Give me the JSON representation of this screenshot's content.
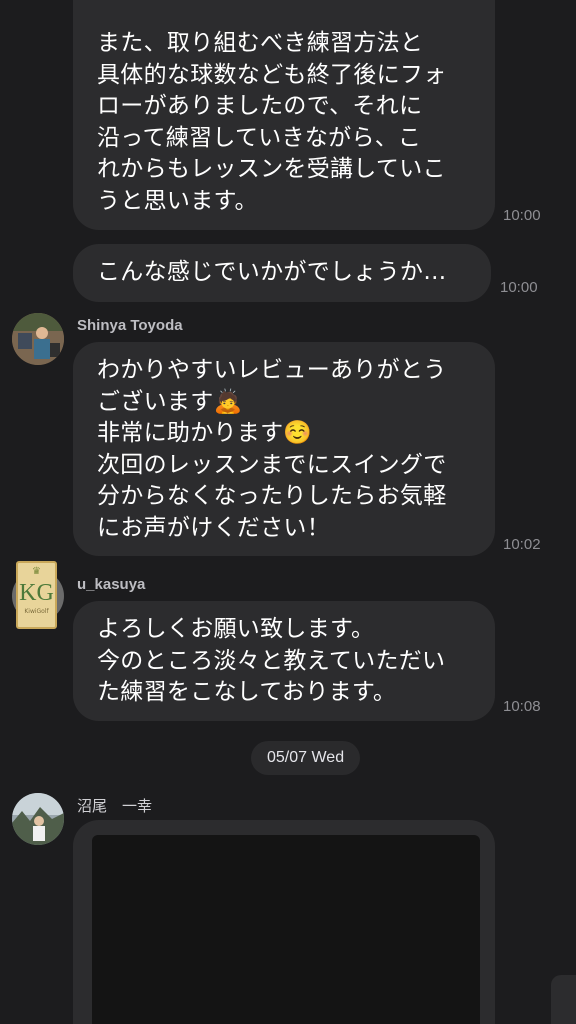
{
  "messages": [
    {
      "text": "また、取り組むべき練習方法と\n具体的な球数なども終了後にフォ\nローがありましたので、それに\n沿って練習していきながら、こ\nれからもレッスンを受講していこ\nうと思います。",
      "time": "10:00"
    },
    {
      "text": "こんな感じでいかがでしょうか…",
      "time": "10:00"
    },
    {
      "sender": "Shinya Toyoda",
      "text": "わかりやすいレビューありがとう\nございます🙇\n非常に助かります☺️\n次回のレッスンまでにスイングで\n分からなくなったりしたらお気軽\nにお声がけください！",
      "time": "10:02"
    },
    {
      "sender": "u_kasuya",
      "avatar_text": "KG",
      "avatar_subtext": "KiwiGolf",
      "text": "よろしくお願い致します。\n今のところ淡々と教えていただい\nた練習をこなしております。",
      "time": "10:08"
    },
    {
      "sender": "沼尾　一幸"
    }
  ],
  "date_separator": "05/07 Wed",
  "colors": {
    "background": "#1c1c1e",
    "bubble": "#2c2c2e",
    "time": "#8e8e93"
  }
}
